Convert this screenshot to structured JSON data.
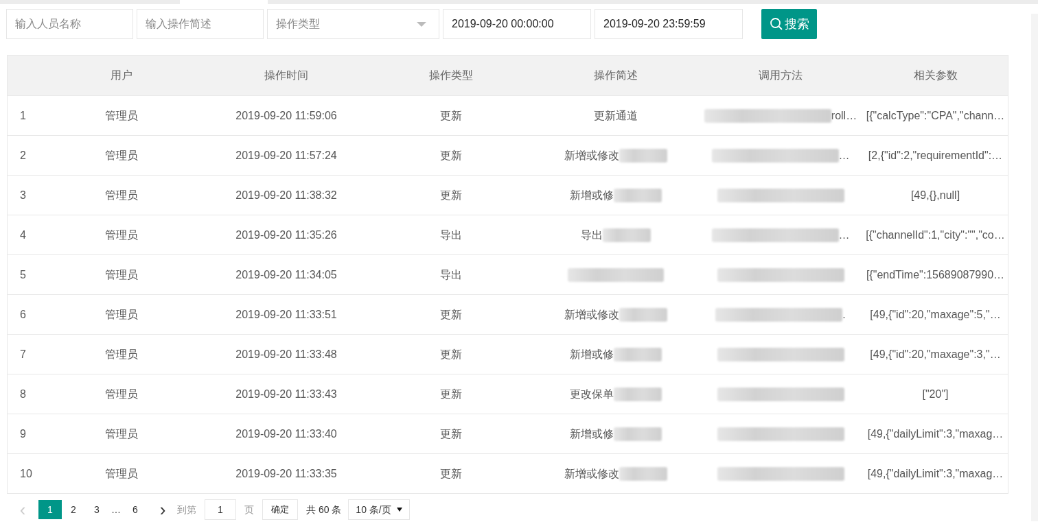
{
  "filters": {
    "name": {
      "placeholder": "输入人员名称"
    },
    "description": {
      "placeholder": "输入操作简述"
    },
    "type": {
      "placeholder": "操作类型"
    },
    "start": {
      "value": "2019-09-20 00:00:00"
    },
    "end": {
      "value": "2019-09-20 23:59:59"
    },
    "search_button": "搜索"
  },
  "table": {
    "columns": [
      "用户",
      "操作时间",
      "操作类型",
      "操作简述",
      "调用方法",
      "相关参数"
    ],
    "rows": [
      {
        "index": "1",
        "user": "管理员",
        "time": "2019-09-20 11:59:06",
        "type": "更新",
        "description": "更新通道",
        "description_blurred": false,
        "method": "roll…",
        "method_blurred": true,
        "params": "[{\"calcType\":\"CPA\",\"chann…"
      },
      {
        "index": "2",
        "user": "管理员",
        "time": "2019-09-20 11:57:24",
        "type": "更新",
        "description": "新增或修改",
        "description_blurred": true,
        "method": "…",
        "method_blurred": true,
        "params": "[2,{\"id\":2,\"requirementId\":…"
      },
      {
        "index": "3",
        "user": "管理员",
        "time": "2019-09-20 11:38:32",
        "type": "更新",
        "description": "新增或修",
        "description_blurred": true,
        "method_blurred": true,
        "params": "[49,{},null]"
      },
      {
        "index": "4",
        "user": "管理员",
        "time": "2019-09-20 11:35:26",
        "type": "导出",
        "description": "导出",
        "description_blurred": true,
        "method": "…",
        "method_blurred": true,
        "params": "[{\"channelId\":1,\"city\":\"\",\"co…"
      },
      {
        "index": "5",
        "user": "管理员",
        "time": "2019-09-20 11:34:05",
        "type": "导出",
        "description_blurred": true,
        "method_blurred": true,
        "params": "[{\"endTime\":15689087990…"
      },
      {
        "index": "6",
        "user": "管理员",
        "time": "2019-09-20 11:33:51",
        "type": "更新",
        "description": "新增或修改",
        "description_blurred": true,
        "method": ".",
        "method_blurred": true,
        "params": "[49,{\"id\":20,\"maxage\":5,\"…"
      },
      {
        "index": "7",
        "user": "管理员",
        "time": "2019-09-20 11:33:48",
        "type": "更新",
        "description": "新增或修",
        "description_blurred": true,
        "method_blurred": true,
        "params": "[49,{\"id\":20,\"maxage\":3,\"…"
      },
      {
        "index": "8",
        "user": "管理员",
        "time": "2019-09-20 11:33:43",
        "type": "更新",
        "description": "更改保单",
        "description_blurred": true,
        "method_blurred": true,
        "params": "[\"20\"]"
      },
      {
        "index": "9",
        "user": "管理员",
        "time": "2019-09-20 11:33:40",
        "type": "更新",
        "description": "新增或修",
        "description_blurred": true,
        "method_blurred": true,
        "params": "[49,{\"dailyLimit\":3,\"maxag…"
      },
      {
        "index": "10",
        "user": "管理员",
        "time": "2019-09-20 11:33:35",
        "type": "更新",
        "description": "新增或修改",
        "description_blurred": true,
        "method_blurred": true,
        "params": "[49,{\"dailyLimit\":3,\"maxag…"
      }
    ]
  },
  "pagination": {
    "prev": "‹",
    "pages": [
      {
        "label": "1",
        "selected": true
      },
      {
        "label": "2",
        "selected": false
      },
      {
        "label": "3",
        "selected": false
      },
      {
        "label": "…",
        "selected": false,
        "kind": "ellipsis"
      },
      {
        "label": "6",
        "selected": false
      }
    ],
    "next": "›",
    "goto_label": "到第",
    "goto_value": "1",
    "page_unit": "页",
    "confirm": "确定",
    "total": "共 60 条",
    "page_size": "10 条/页"
  }
}
